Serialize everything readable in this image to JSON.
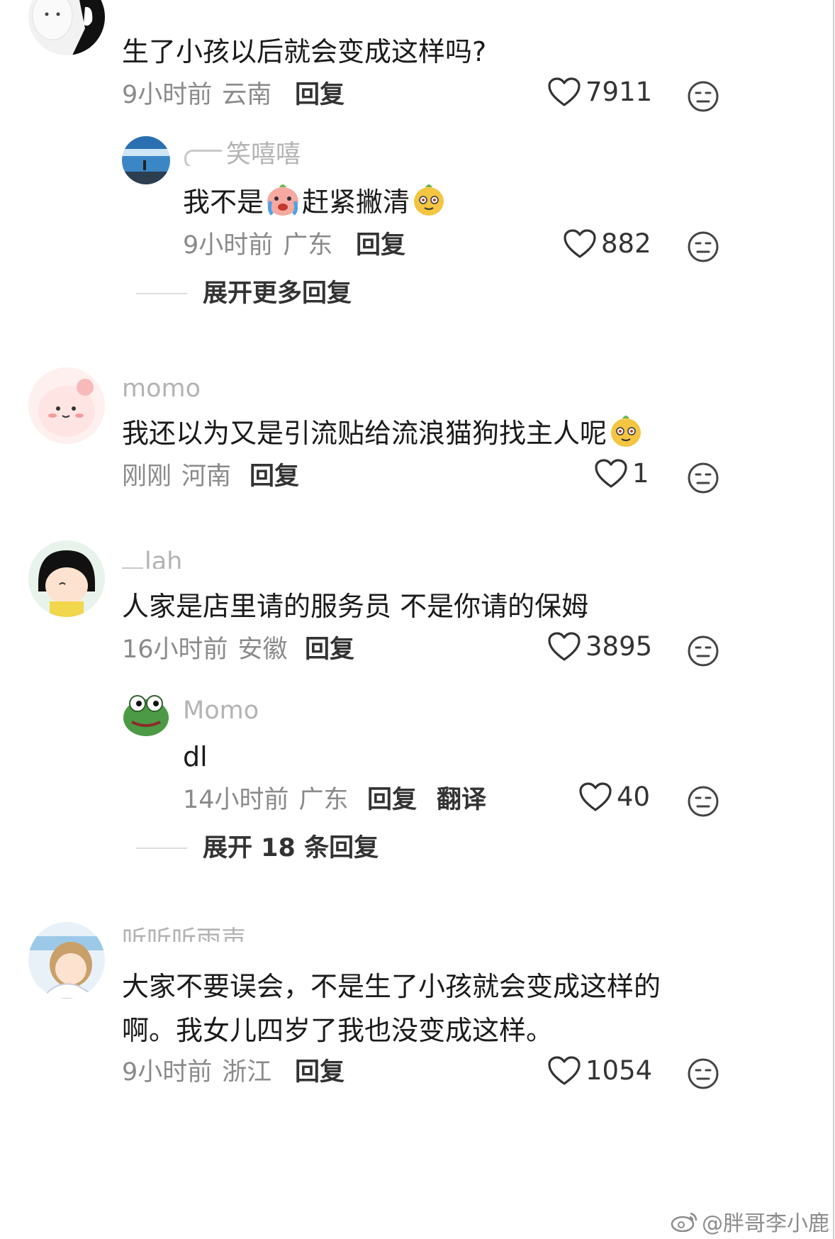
{
  "comments": [
    {
      "text": "生了小孩以后就会变成这样吗?",
      "time": "9小时前",
      "location": "云南",
      "reply_label": "回复",
      "likes": "7911",
      "replies": [
        {
          "username": "笑嘻嘻",
          "text_a": "我不是",
          "text_b": "赶紧撇清",
          "time": "9小时前",
          "location": "广东",
          "reply_label": "回复",
          "likes": "882"
        }
      ],
      "expand_label": "展开更多回复"
    },
    {
      "username": "momo",
      "text": "我还以为又是引流贴给流浪猫狗找主人呢",
      "time": "刚刚",
      "location": "河南",
      "reply_label": "回复",
      "likes": "1"
    },
    {
      "username": "lah",
      "text": "人家是店里请的服务员 不是你请的保姆",
      "time": "16小时前",
      "location": "安徽",
      "reply_label": "回复",
      "likes": "3895",
      "replies": [
        {
          "username": "Momo",
          "text": "dl",
          "time": "14小时前",
          "location": "广东",
          "reply_label": "回复",
          "translate_label": "翻译",
          "likes": "40"
        }
      ],
      "expand_label": "展开 18 条回复"
    },
    {
      "username": "听听听雨声",
      "text_line1": "大家不要误会，不是生了小孩就会变成这样的",
      "text_line2": "啊。我女儿四岁了我也没变成这样。",
      "time": "9小时前",
      "location": "浙江",
      "reply_label": "回复",
      "likes": "1054"
    }
  ],
  "icons": {
    "like": "heart-outline-icon",
    "dislike": "neutral-face-icon",
    "watermark": "weibo-logo-icon"
  },
  "colors": {
    "text": "#1a1a1a",
    "meta": "#8a8a8a",
    "username": "#b3b3b3",
    "accent_bold": "#333333"
  },
  "watermark": "@胖哥李小鹿"
}
